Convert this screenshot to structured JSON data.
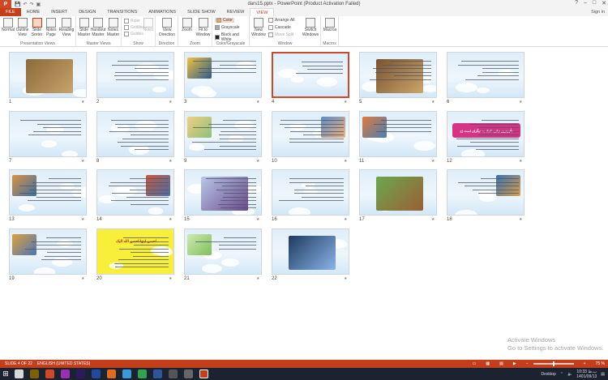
{
  "app": {
    "title": "dars15.pptx - PowerPoint (Product Activation Failed)",
    "icon_letter": "P",
    "sign_in": "Sign in",
    "win_minimize": "–",
    "win_maximize": "□",
    "win_close": "✕",
    "help": "?"
  },
  "qat": {
    "save": "💾",
    "undo": "↶",
    "redo": "↷",
    "start": "▣"
  },
  "tabs": [
    "FILE",
    "HOME",
    "INSERT",
    "DESIGN",
    "TRANSITIONS",
    "ANIMATIONS",
    "SLIDE SHOW",
    "REVIEW",
    "VIEW"
  ],
  "active_tab": "VIEW",
  "ribbon": {
    "presentation_views": {
      "label": "Presentation Views",
      "buttons": [
        "Normal",
        "Outline View",
        "Slide Sorter",
        "Notes Page",
        "Reading View"
      ]
    },
    "master_views": {
      "label": "Master Views",
      "buttons": [
        "Slide Master",
        "Handout Master",
        "Notes Master"
      ]
    },
    "show": {
      "label": "Show",
      "items": [
        "Ruler",
        "Gridlines",
        "Guides"
      ],
      "notes": "Notes"
    },
    "direction": {
      "label": "Direction",
      "button": "View Direction"
    },
    "zoom": {
      "label": "Zoom",
      "buttons": [
        "Zoom",
        "Fit to Window"
      ]
    },
    "color": {
      "label": "Color/Grayscale",
      "items": [
        "Color",
        "Grayscale",
        "Black and White"
      ]
    },
    "window": {
      "label": "Window",
      "new_window": "New Window",
      "items": [
        "Arrange All",
        "Cascade",
        "Move Split"
      ],
      "switch": "Switch Windows"
    },
    "macros": {
      "label": "Macros",
      "button": "Macros"
    }
  },
  "slides": [
    {
      "num": "1"
    },
    {
      "num": "2"
    },
    {
      "num": "3"
    },
    {
      "num": "4"
    },
    {
      "num": "5"
    },
    {
      "num": "6"
    },
    {
      "num": "7"
    },
    {
      "num": "8"
    },
    {
      "num": "9"
    },
    {
      "num": "10"
    },
    {
      "num": "11"
    },
    {
      "num": "12"
    },
    {
      "num": "13"
    },
    {
      "num": "14"
    },
    {
      "num": "15"
    },
    {
      "num": "16"
    },
    {
      "num": "17"
    },
    {
      "num": "18"
    },
    {
      "num": "19"
    },
    {
      "num": "20"
    },
    {
      "num": "21"
    },
    {
      "num": "22"
    }
  ],
  "slide_texts": {
    "s12": "تأثیرترین نیکی، کمک به دیگران است (ع",
    "s20": "احسن ایتها احسن الله الیک"
  },
  "selected_slide": "4",
  "star_glyph": "★",
  "watermark": {
    "line1": "Activate Windows",
    "line2": "Go to Settings to activate Windows."
  },
  "status": {
    "slide_info": "SLIDE 4 OF 22",
    "language": "ENGLISH (UNITED STATES)",
    "zoom": "75 %"
  },
  "taskbar": {
    "start": "⊞",
    "desktop": "Desktop",
    "time": "10:33 ب.ظ",
    "date": "1401/09/13"
  },
  "colors": {
    "accent": "#c43e1c",
    "taskbar": "#1c2330"
  }
}
